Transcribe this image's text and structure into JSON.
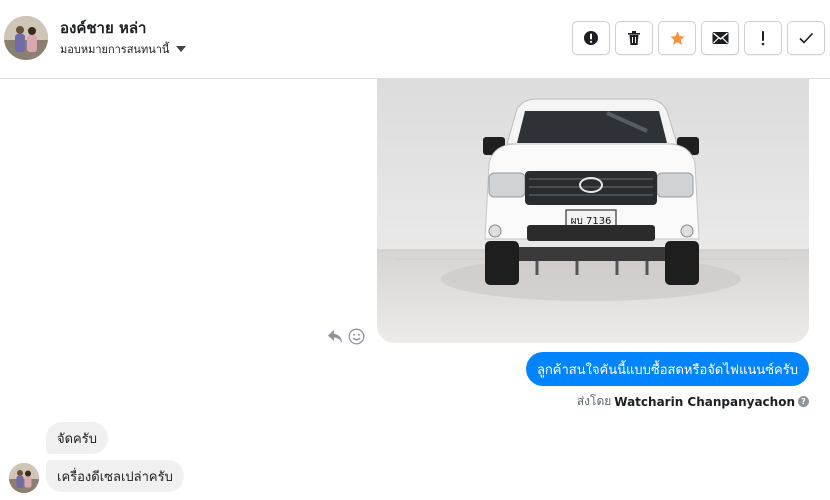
{
  "contact": {
    "name": "องค์ชาย หล่า",
    "assign_label": "มอบหมายการสนทนานี้"
  },
  "toolbar": {
    "buttons": [
      {
        "name": "mark-spam-button",
        "icon": "exclamation-circle-icon"
      },
      {
        "name": "delete-button",
        "icon": "trash-icon"
      },
      {
        "name": "star-button",
        "icon": "star-icon"
      },
      {
        "name": "mark-unread-button",
        "icon": "envelope-icon"
      },
      {
        "name": "follow-up-button",
        "icon": "exclamation-icon"
      },
      {
        "name": "mark-done-button",
        "icon": "check-icon"
      }
    ],
    "star_color": "#f7923a"
  },
  "conversation": {
    "image": {
      "subject": "white pickup truck",
      "plate_text": "ผบ 7136"
    },
    "outgoing": {
      "text": "ลูกค้าสนใจคันนี้แบบซื้อสดหรือจัดไฟแนนซ์ครับ",
      "sent_by_label": "ส่งโดย",
      "sent_by_name": "Watcharin Chanpanyachon",
      "bubble_color": "#0084ff"
    },
    "incoming": [
      {
        "text": "จัดครับ"
      },
      {
        "text": "เครื่องดีเซลเปล่าครับ"
      }
    ]
  }
}
